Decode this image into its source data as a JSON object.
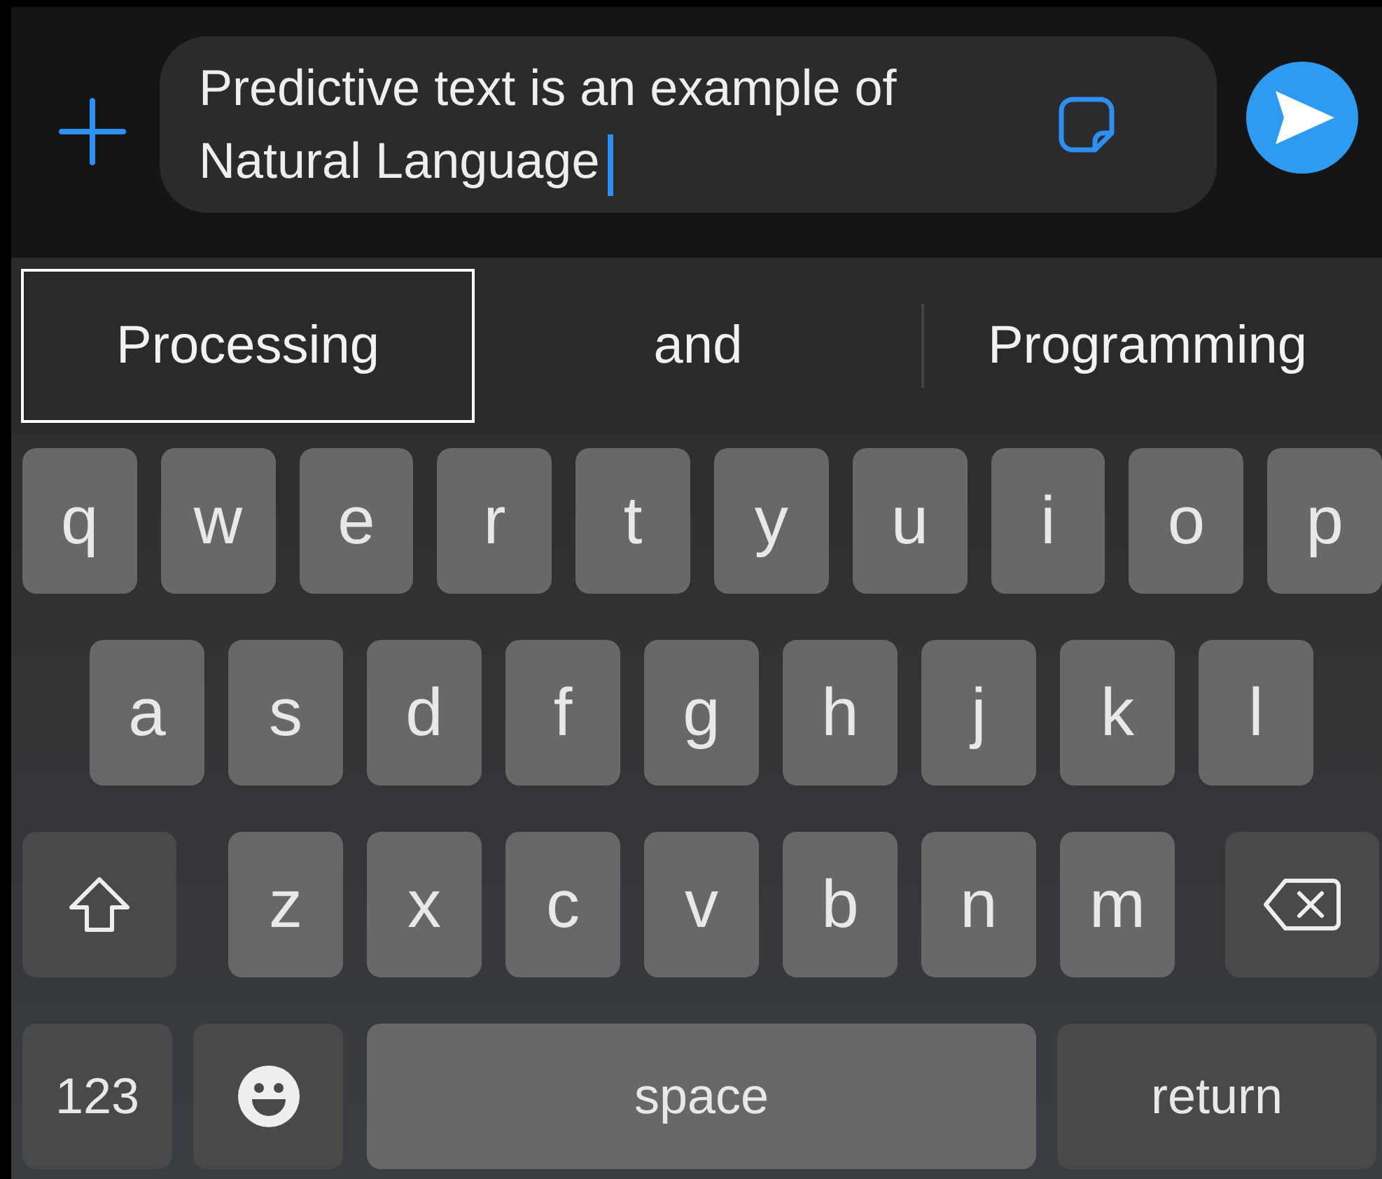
{
  "message_field": {
    "value": "Predictive text is an example of Natural Language"
  },
  "suggestions": [
    {
      "label": "Processing",
      "selected": true
    },
    {
      "label": "and",
      "selected": false
    },
    {
      "label": "Programming",
      "selected": false
    }
  ],
  "keyboard": {
    "rows": [
      {
        "keys": [
          {
            "kind": "letter",
            "label": "q"
          },
          {
            "kind": "letter",
            "label": "w"
          },
          {
            "kind": "letter",
            "label": "e"
          },
          {
            "kind": "letter",
            "label": "r"
          },
          {
            "kind": "letter",
            "label": "t"
          },
          {
            "kind": "letter",
            "label": "y"
          },
          {
            "kind": "letter",
            "label": "u"
          },
          {
            "kind": "letter",
            "label": "i"
          },
          {
            "kind": "letter",
            "label": "o"
          },
          {
            "kind": "letter",
            "label": "p"
          }
        ]
      },
      {
        "keys": [
          {
            "kind": "letter",
            "label": "a"
          },
          {
            "kind": "letter",
            "label": "s"
          },
          {
            "kind": "letter",
            "label": "d"
          },
          {
            "kind": "letter",
            "label": "f"
          },
          {
            "kind": "letter",
            "label": "g"
          },
          {
            "kind": "letter",
            "label": "h"
          },
          {
            "kind": "letter",
            "label": "j"
          },
          {
            "kind": "letter",
            "label": "k"
          },
          {
            "kind": "letter",
            "label": "l"
          }
        ]
      },
      {
        "keys": [
          {
            "kind": "shift"
          },
          {
            "kind": "letter",
            "label": "z"
          },
          {
            "kind": "letter",
            "label": "x"
          },
          {
            "kind": "letter",
            "label": "c"
          },
          {
            "kind": "letter",
            "label": "v"
          },
          {
            "kind": "letter",
            "label": "b"
          },
          {
            "kind": "letter",
            "label": "n"
          },
          {
            "kind": "letter",
            "label": "m"
          },
          {
            "kind": "delete"
          }
        ]
      },
      {
        "keys": [
          {
            "kind": "mode",
            "label": "123"
          },
          {
            "kind": "emoji"
          },
          {
            "kind": "space",
            "label": "space"
          },
          {
            "kind": "return",
            "label": "return"
          }
        ]
      }
    ]
  }
}
